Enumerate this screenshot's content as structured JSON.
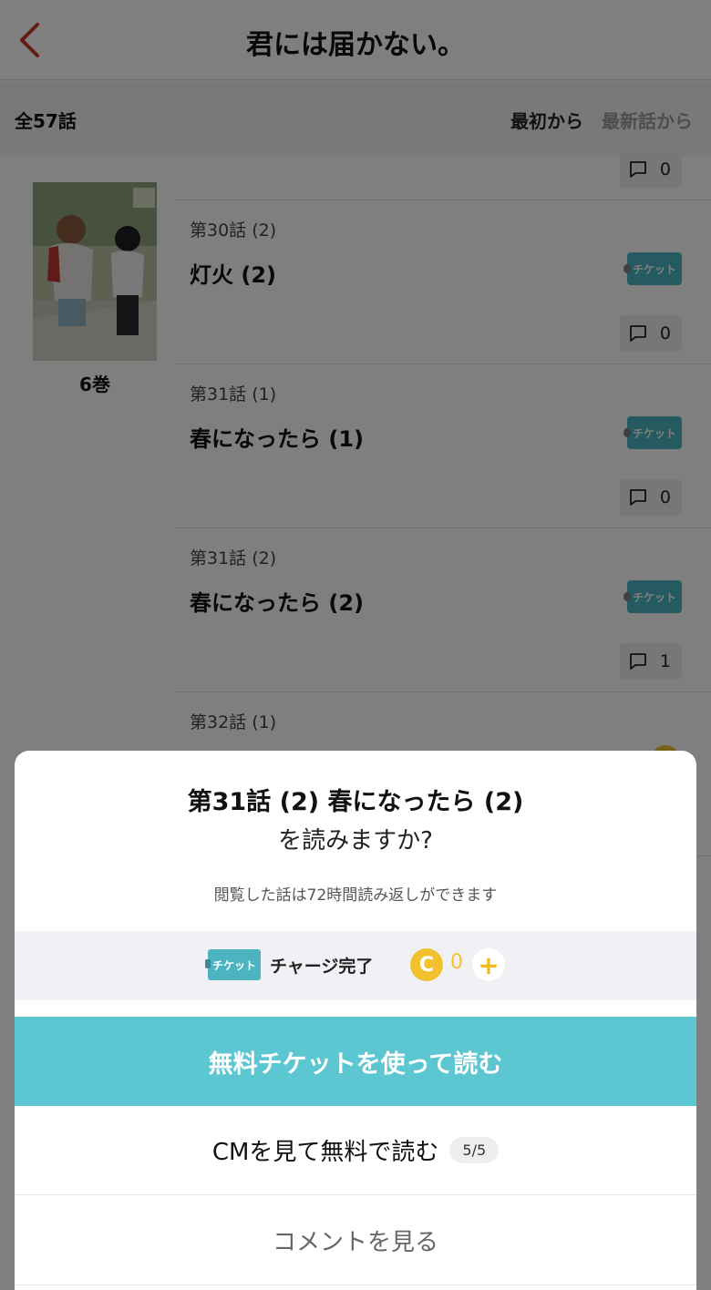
{
  "header": {
    "title": "君には届かない。"
  },
  "list_header": {
    "count": "全57話",
    "sort_first": "最初から",
    "sort_latest": "最新話から"
  },
  "volume": {
    "label": "6巻"
  },
  "top_comment_count": "0",
  "episodes": [
    {
      "number": "第30話 (2)",
      "title": "灯火 (2)",
      "badge": "チケット",
      "comments": "0"
    },
    {
      "number": "第31話 (1)",
      "title": "春になったら (1)",
      "badge": "チケット",
      "comments": "0"
    },
    {
      "number": "第31話 (2)",
      "title": "春になったら (2)",
      "badge": "チケット",
      "comments": "1"
    },
    {
      "number": "第32話 (1)"
    }
  ],
  "modal": {
    "title": "第31話 (2) 春になったら (2)",
    "question": "を読みますか?",
    "note": "閲覧した話は72時間読み返しができます",
    "ticket_badge": "チケット",
    "charge_status": "チャージ完了",
    "coin_letter": "C",
    "coin_count": "0",
    "plus": "+",
    "primary_button": "無料チケットを使って読む",
    "cm_button": "CMを見て無料で読む",
    "cm_quota": "5/5",
    "comments_button": "コメントを見る"
  },
  "colors": {
    "accent_teal": "#5cc6d1",
    "ticket_teal": "#4bb4c0",
    "coin_yellow": "#f2c12e",
    "back_red": "#c0392b"
  }
}
